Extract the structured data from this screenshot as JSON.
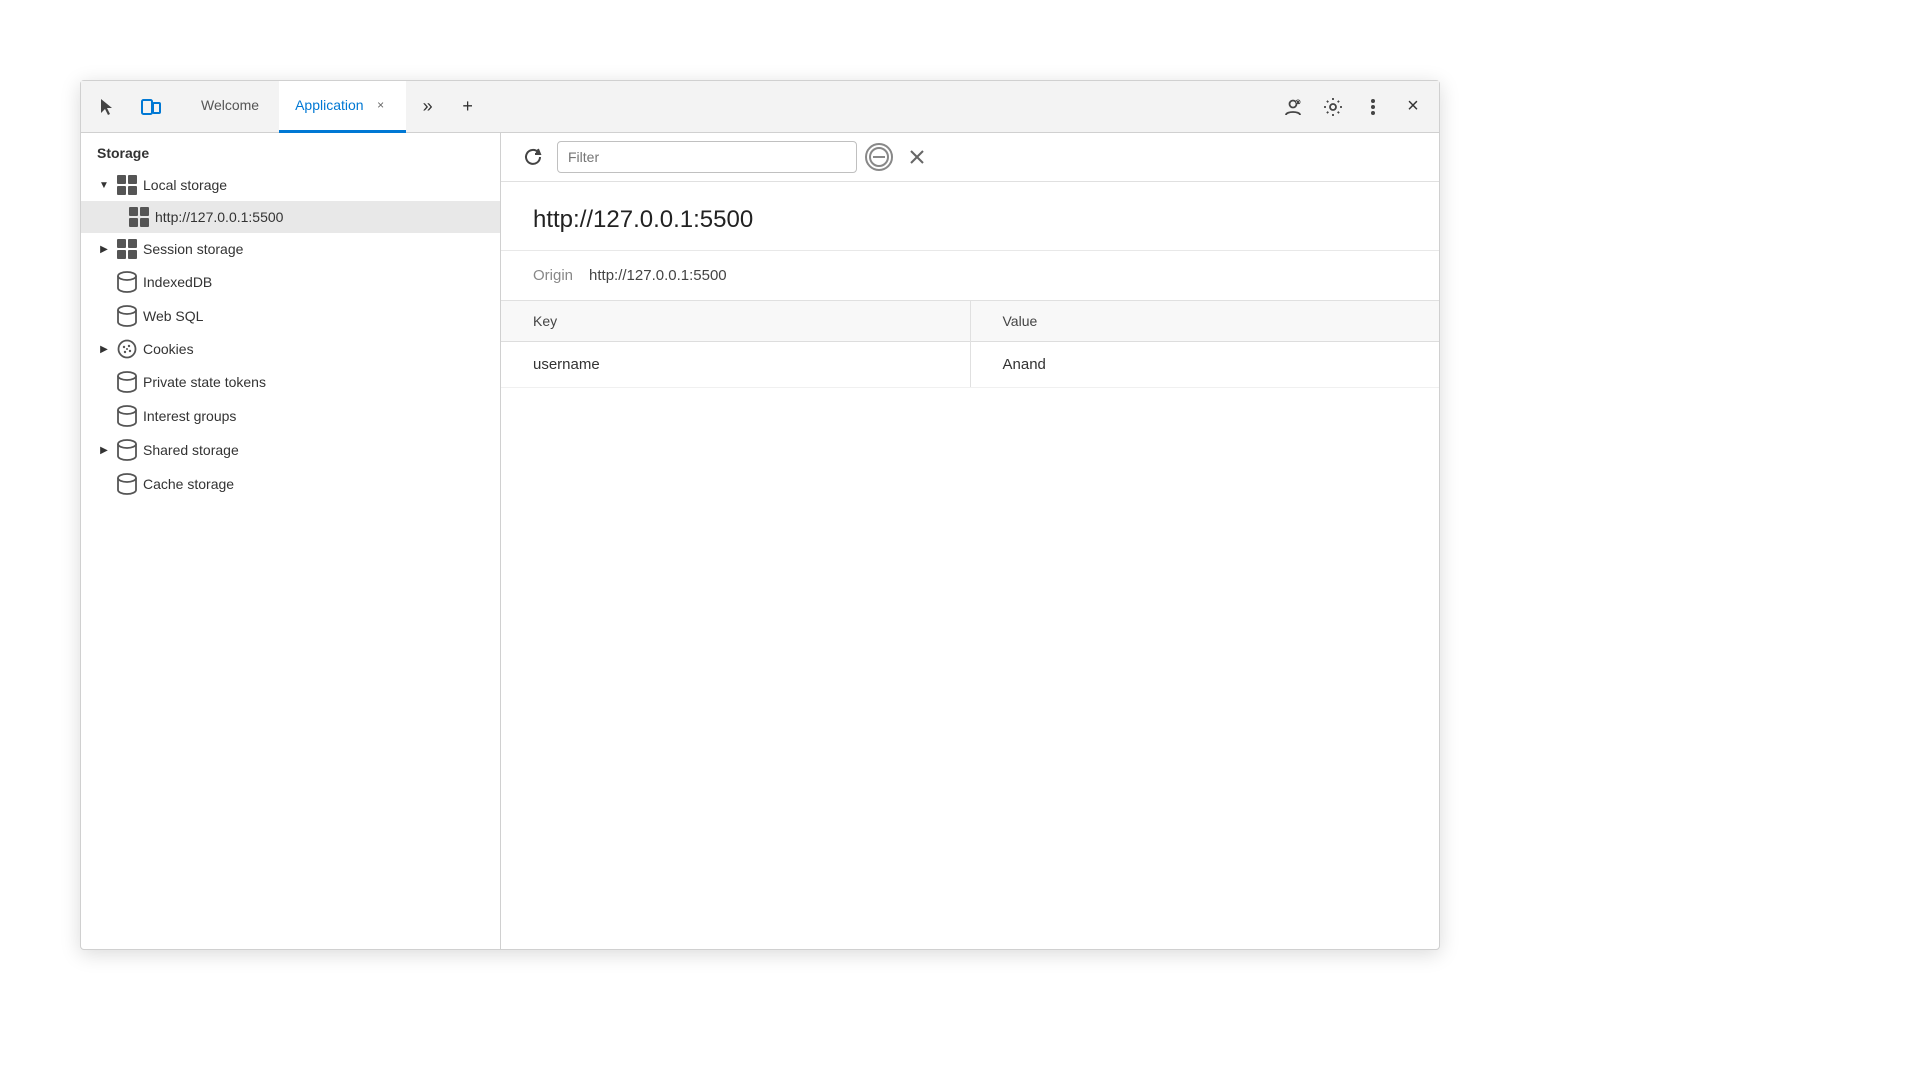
{
  "tabs": [
    {
      "id": "welcome",
      "label": "Welcome",
      "active": false,
      "closable": false
    },
    {
      "id": "application",
      "label": "Application",
      "active": true,
      "closable": true
    }
  ],
  "toolbar_icons": {
    "cursor": "cursor-icon",
    "panels": "panels-icon",
    "more_tabs": ">>",
    "add_tab": "+",
    "user": "user-icon",
    "settings": "settings-icon",
    "more": "more-icon",
    "close": "×"
  },
  "sidebar": {
    "header": "Storage",
    "items": [
      {
        "id": "local-storage",
        "label": "Local storage",
        "icon": "grid",
        "level": 1,
        "expanded": true,
        "expandable": true
      },
      {
        "id": "local-storage-origin",
        "label": "http://127.0.0.1:5500",
        "icon": "grid",
        "level": 2,
        "selected": true
      },
      {
        "id": "session-storage",
        "label": "Session storage",
        "icon": "grid",
        "level": 1,
        "expandable": true
      },
      {
        "id": "indexeddb",
        "label": "IndexedDB",
        "icon": "cylinder",
        "level": 1
      },
      {
        "id": "websql",
        "label": "Web SQL",
        "icon": "cylinder",
        "level": 1
      },
      {
        "id": "cookies",
        "label": "Cookies",
        "icon": "cookie",
        "level": 1,
        "expandable": true
      },
      {
        "id": "private-state",
        "label": "Private state tokens",
        "icon": "cylinder",
        "level": 1
      },
      {
        "id": "interest-groups",
        "label": "Interest groups",
        "icon": "cylinder",
        "level": 1
      },
      {
        "id": "shared-storage",
        "label": "Shared storage",
        "icon": "cylinder",
        "level": 1,
        "expandable": true
      },
      {
        "id": "cache-storage",
        "label": "Cache storage",
        "icon": "cylinder",
        "level": 1
      }
    ]
  },
  "content": {
    "filter_placeholder": "Filter",
    "title": "http://127.0.0.1:5500",
    "origin_label": "Origin",
    "origin_value": "http://127.0.0.1:5500",
    "table": {
      "columns": [
        {
          "id": "key",
          "label": "Key"
        },
        {
          "id": "value",
          "label": "Value"
        }
      ],
      "rows": [
        {
          "key": "username",
          "value": "Anand"
        }
      ]
    }
  }
}
